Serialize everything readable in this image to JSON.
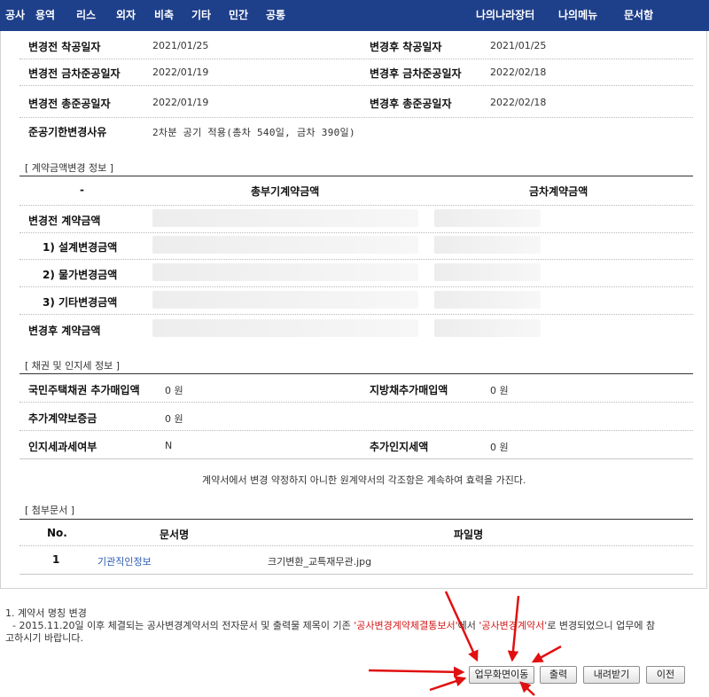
{
  "top_nav": {
    "left": [
      "공사",
      "용역",
      "리스",
      "외자",
      "비축",
      "기타",
      "민간",
      "공통"
    ],
    "right": [
      "나의나라장터",
      "나의메뉴",
      "문서함"
    ]
  },
  "dates": {
    "before_start_label": "변경전 착공일자",
    "before_start": "2021/01/25",
    "after_start_label": "변경후 착공일자",
    "after_start": "2021/01/25",
    "before_partial_label": "변경전 금차준공일자",
    "before_partial": "2022/01/19",
    "after_partial_label": "변경후 금차준공일자",
    "after_partial": "2022/02/18",
    "before_total_label": "변경전 총준공일자",
    "before_total": "2022/01/19",
    "after_total_label": "변경후 총준공일자",
    "after_total": "2022/02/18",
    "reason_label": "준공기한변경사유",
    "reason": "2차분 공기 적용(총차 540일, 금차 390일)"
  },
  "amount": {
    "section_title": "[ 계약금액변경 정보 ]",
    "col_dash": "-",
    "col_total": "총부기계약금액",
    "col_current": "금차계약금액",
    "rows": [
      "변경전 계약금액",
      "1) 설계변경금액",
      "2) 물가변경금액",
      "3) 기타변경금액",
      "변경후 계약금액"
    ]
  },
  "bond": {
    "section_title": "[ 채권 및 인지세 정보 ]",
    "national_label": "국민주택채권 추가매입액",
    "national_value": "0 원",
    "local_label": "지방채추가매입액",
    "local_value": "0 원",
    "guarantee_label": "추가계약보증금",
    "guarantee_value": "0 원",
    "stamp_flag_label": "인지세과세여부",
    "stamp_flag_value": "N",
    "stamp_extra_label": "추가인지세액",
    "stamp_extra_value": "0 원"
  },
  "continuity_note": "계약서에서 변경 약정하지 아니한 원계약서의 각조항은 계속하여 효력을 가진다.",
  "attachments": {
    "section_title": "[ 첨부문서 ]",
    "col_no": "No.",
    "col_doc": "문서명",
    "col_file": "파일명",
    "rows": [
      {
        "no": "1",
        "doc": "기관직인정보",
        "file": "크기변환_교특재무관.jpg"
      }
    ]
  },
  "notes": {
    "line1": "1. 계약서 명칭 변경",
    "line2_a": "- 2015.11.20일 이후 체결되는 공사변경계약서의 전자문서 및 출력물 제목이 기존 ",
    "line2_red1": "'공사변경계약체결통보서'",
    "line2_b": "에서 ",
    "line2_red2": "'공사변경계약서'",
    "line2_c": "로 변경되었으니 업무에 참",
    "line3": "고하시기 바랍니다."
  },
  "buttons": {
    "goto": "업무화면이동",
    "print": "출력",
    "download": "내려받기",
    "prev": "이전"
  },
  "colors": {
    "nav_bg": "#1e3f8a",
    "link": "#2a5bb3",
    "highlight_red": "#d61818",
    "arrow_red": "#e01010"
  }
}
